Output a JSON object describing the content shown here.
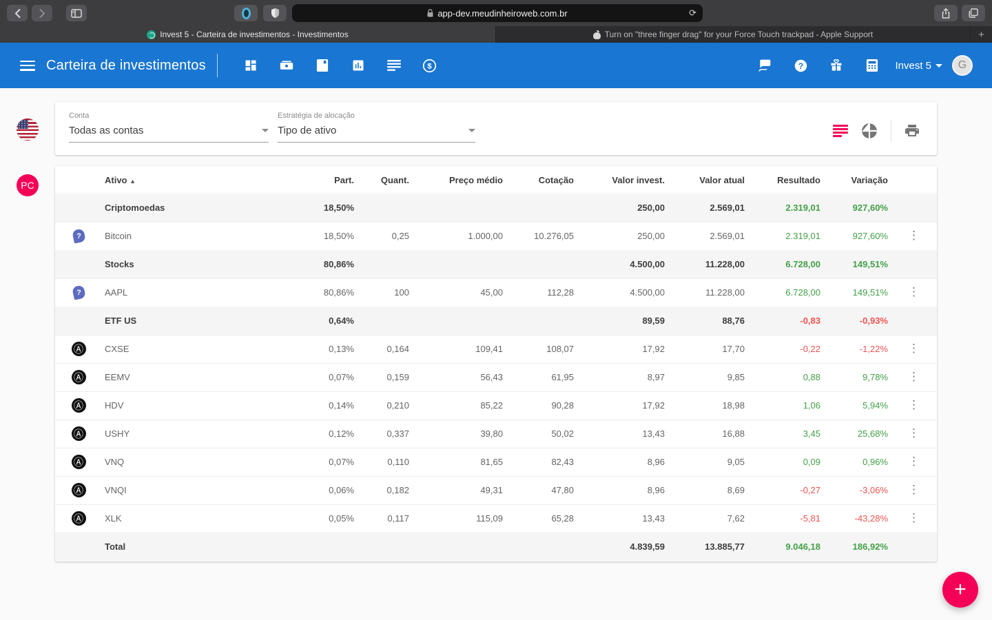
{
  "browser": {
    "url": "app-dev.meudinheiroweb.com.br",
    "tabs": [
      {
        "title": "Invest 5 - Carteira de investimentos - Investimentos"
      },
      {
        "title": "Turn on \"three finger drag\" for your Force Touch trackpad - Apple Support"
      }
    ],
    "new_tab_label": "+"
  },
  "appbar": {
    "title": "Carteira de investimentos",
    "account_label": "Invest 5",
    "avatar_initial": "G"
  },
  "floating": {
    "profile_initials": "PC"
  },
  "filters": {
    "conta": {
      "label": "Conta",
      "value": "Todas as contas"
    },
    "estrategia": {
      "label": "Estratégia de alocação",
      "value": "Tipo de ativo"
    }
  },
  "table": {
    "headers": [
      "Ativo",
      "Part.",
      "Quant.",
      "Preço médio",
      "Cotação",
      "Valor invest.",
      "Valor atual",
      "Resultado",
      "Variação"
    ],
    "sort_indicator": "▲",
    "rows": [
      {
        "type": "group",
        "icon": null,
        "name": "Criptomoedas",
        "part": "18,50%",
        "quant": "",
        "preco": "",
        "cotacao": "",
        "vinvest": "250,00",
        "vatual": "2.569,01",
        "res": "2.319,01",
        "var": "927,60%",
        "trend": "pos"
      },
      {
        "type": "asset",
        "icon": "pin",
        "name": "Bitcoin",
        "part": "18,50%",
        "quant": "0,25",
        "preco": "1.000,00",
        "cotacao": "10.276,05",
        "vinvest": "250,00",
        "vatual": "2.569,01",
        "res": "2.319,01",
        "var": "927,60%",
        "trend": "pos"
      },
      {
        "type": "group",
        "icon": null,
        "name": "Stocks",
        "part": "80,86%",
        "quant": "",
        "preco": "",
        "cotacao": "",
        "vinvest": "4.500,00",
        "vatual": "11.228,00",
        "res": "6.728,00",
        "var": "149,51%",
        "trend": "pos"
      },
      {
        "type": "asset",
        "icon": "pin",
        "name": "AAPL",
        "part": "80,86%",
        "quant": "100",
        "preco": "45,00",
        "cotacao": "112,28",
        "vinvest": "4.500,00",
        "vatual": "11.228,00",
        "res": "6.728,00",
        "var": "149,51%",
        "trend": "pos"
      },
      {
        "type": "group",
        "icon": null,
        "name": "ETF US",
        "part": "0,64%",
        "quant": "",
        "preco": "",
        "cotacao": "",
        "vinvest": "89,59",
        "vatual": "88,76",
        "res": "-0,83",
        "var": "-0,93%",
        "trend": "neg"
      },
      {
        "type": "asset",
        "icon": "etf",
        "name": "CXSE",
        "part": "0,13%",
        "quant": "0,164",
        "preco": "109,41",
        "cotacao": "108,07",
        "vinvest": "17,92",
        "vatual": "17,70",
        "res": "-0,22",
        "var": "-1,22%",
        "trend": "neg"
      },
      {
        "type": "asset",
        "icon": "etf",
        "name": "EEMV",
        "part": "0,07%",
        "quant": "0,159",
        "preco": "56,43",
        "cotacao": "61,95",
        "vinvest": "8,97",
        "vatual": "9,85",
        "res": "0,88",
        "var": "9,78%",
        "trend": "pos"
      },
      {
        "type": "asset",
        "icon": "etf",
        "name": "HDV",
        "part": "0,14%",
        "quant": "0,210",
        "preco": "85,22",
        "cotacao": "90,28",
        "vinvest": "17,92",
        "vatual": "18,98",
        "res": "1,06",
        "var": "5,94%",
        "trend": "pos"
      },
      {
        "type": "asset",
        "icon": "etf",
        "name": "USHY",
        "part": "0,12%",
        "quant": "0,337",
        "preco": "39,80",
        "cotacao": "50,02",
        "vinvest": "13,43",
        "vatual": "16,88",
        "res": "3,45",
        "var": "25,68%",
        "trend": "pos"
      },
      {
        "type": "asset",
        "icon": "etf",
        "name": "VNQ",
        "part": "0,07%",
        "quant": "0,110",
        "preco": "81,65",
        "cotacao": "82,43",
        "vinvest": "8,96",
        "vatual": "9,05",
        "res": "0,09",
        "var": "0,96%",
        "trend": "pos"
      },
      {
        "type": "asset",
        "icon": "etf",
        "name": "VNQI",
        "part": "0,06%",
        "quant": "0,182",
        "preco": "49,31",
        "cotacao": "47,80",
        "vinvest": "8,96",
        "vatual": "8,69",
        "res": "-0,27",
        "var": "-3,06%",
        "trend": "neg"
      },
      {
        "type": "asset",
        "icon": "etf",
        "name": "XLK",
        "part": "0,05%",
        "quant": "0,117",
        "preco": "115,09",
        "cotacao": "65,28",
        "vinvest": "13,43",
        "vatual": "7,62",
        "res": "-5,81",
        "var": "-43,28%",
        "trend": "neg"
      },
      {
        "type": "total",
        "icon": null,
        "name": "Total",
        "part": "",
        "quant": "",
        "preco": "",
        "cotacao": "",
        "vinvest": "4.839,59",
        "vatual": "13.885,77",
        "res": "9.046,18",
        "var": "186,92%",
        "trend": "pos"
      }
    ]
  },
  "fab_label": "+",
  "colors": {
    "appbar_blue": "#1976d2",
    "accent_pink": "#f50057",
    "positive_green": "#43a047",
    "negative_red": "#ef5350"
  }
}
